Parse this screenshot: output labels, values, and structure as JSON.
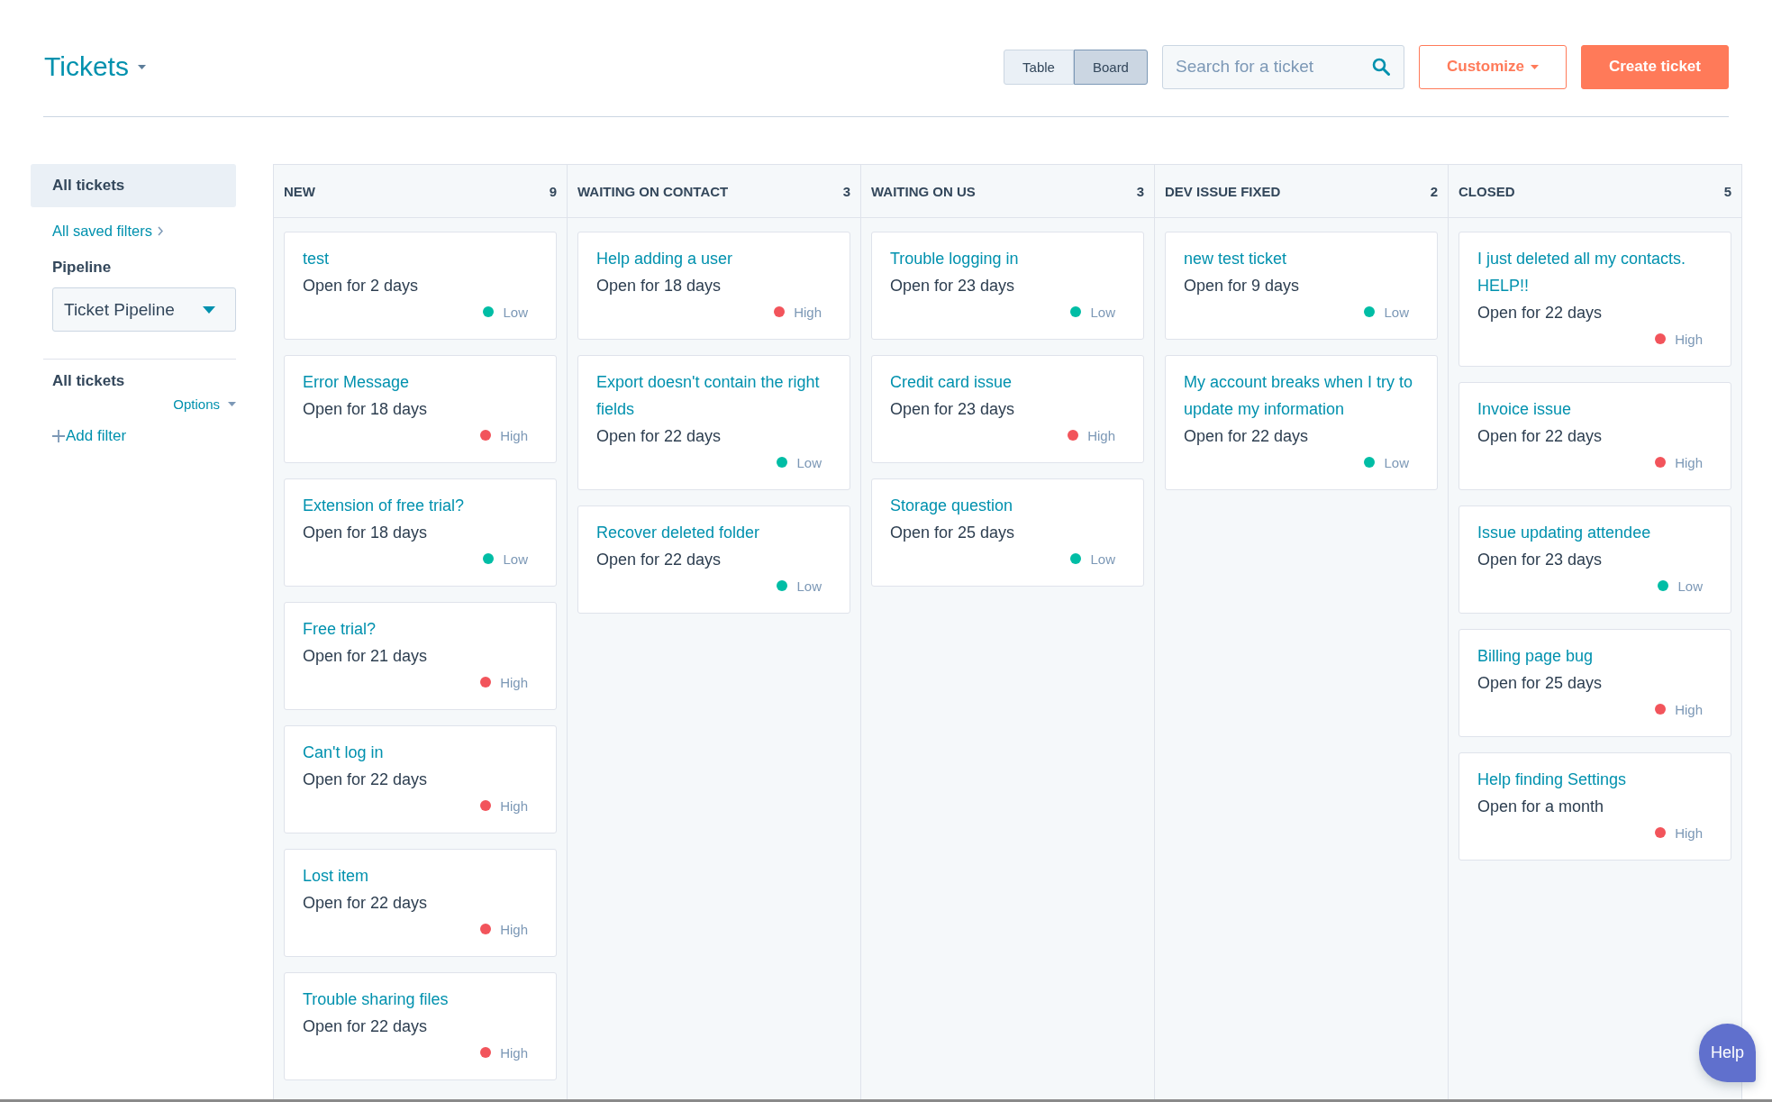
{
  "header": {
    "title": "Tickets",
    "view_toggle": [
      {
        "label": "Table",
        "selected": false
      },
      {
        "label": "Board",
        "selected": true
      }
    ],
    "search": {
      "placeholder": "Search for a ticket"
    },
    "buttons": [
      {
        "label": "Customize",
        "kind": "secondary",
        "dropdown": true
      },
      {
        "label": "Create ticket",
        "kind": "primary",
        "dropdown": false
      }
    ]
  },
  "sidebar": {
    "views": [
      {
        "label": "All tickets",
        "selected": true
      }
    ],
    "saved_filters_link": "All saved filters",
    "pipeline": {
      "label": "Pipeline",
      "value": "Ticket Pipeline"
    },
    "filter_section": {
      "title": "All tickets",
      "options_link": "Options",
      "add_filter_link": "Add filter"
    }
  },
  "board": {
    "columns": [
      {
        "name": "NEW",
        "count": "9",
        "cards": [
          {
            "title": "test",
            "age": "Open for 2 days",
            "priority": "Low",
            "color": "#00bda5"
          },
          {
            "title": "Error Message",
            "age": "Open for 18 days",
            "priority": "High",
            "color": "#f2545b"
          },
          {
            "title": "Extension of free trial?",
            "age": "Open for 18 days",
            "priority": "Low",
            "color": "#00bda5"
          },
          {
            "title": "Free trial?",
            "age": "Open for 21 days",
            "priority": "High",
            "color": "#f2545b"
          },
          {
            "title": "Can't log in",
            "age": "Open for 22 days",
            "priority": "High",
            "color": "#f2545b"
          },
          {
            "title": "Lost item",
            "age": "Open for 22 days",
            "priority": "High",
            "color": "#f2545b"
          },
          {
            "title": "Trouble sharing files",
            "age": "Open for 22 days",
            "priority": "High",
            "color": "#f2545b"
          }
        ]
      },
      {
        "name": "WAITING ON CONTACT",
        "count": "3",
        "cards": [
          {
            "title": "Help adding a user",
            "age": "Open for 18 days",
            "priority": "High",
            "color": "#f2545b"
          },
          {
            "title": "Export doesn't contain the right fields",
            "age": "Open for 22 days",
            "priority": "Low",
            "color": "#00bda5"
          },
          {
            "title": "Recover deleted folder",
            "age": "Open for 22 days",
            "priority": "Low",
            "color": "#00bda5"
          }
        ]
      },
      {
        "name": "WAITING ON US",
        "count": "3",
        "cards": [
          {
            "title": "Trouble logging in",
            "age": "Open for 23 days",
            "priority": "Low",
            "color": "#00bda5"
          },
          {
            "title": "Credit card issue",
            "age": "Open for 23 days",
            "priority": "High",
            "color": "#f2545b"
          },
          {
            "title": "Storage question",
            "age": "Open for 25 days",
            "priority": "Low",
            "color": "#00bda5"
          }
        ]
      },
      {
        "name": "DEV ISSUE FIXED",
        "count": "2",
        "cards": [
          {
            "title": "new test ticket",
            "age": "Open for 9 days",
            "priority": "Low",
            "color": "#00bda5"
          },
          {
            "title": "My account breaks when I try to update my information",
            "age": "Open for 22 days",
            "priority": "Low",
            "color": "#00bda5"
          }
        ]
      },
      {
        "name": "CLOSED",
        "count": "5",
        "cards": [
          {
            "title": "I just deleted all my contacts. HELP!!",
            "age": "Open for 22 days",
            "priority": "High",
            "color": "#f2545b"
          },
          {
            "title": "Invoice issue",
            "age": "Open for 22 days",
            "priority": "High",
            "color": "#f2545b"
          },
          {
            "title": "Issue updating attendee",
            "age": "Open for 23 days",
            "priority": "Low",
            "color": "#00bda5"
          },
          {
            "title": "Billing page bug",
            "age": "Open for 25 days",
            "priority": "High",
            "color": "#f2545b"
          },
          {
            "title": "Help finding Settings",
            "age": "Open for a month",
            "priority": "High",
            "color": "#f2545b"
          }
        ]
      }
    ]
  },
  "help_button": {
    "label": "Help"
  }
}
